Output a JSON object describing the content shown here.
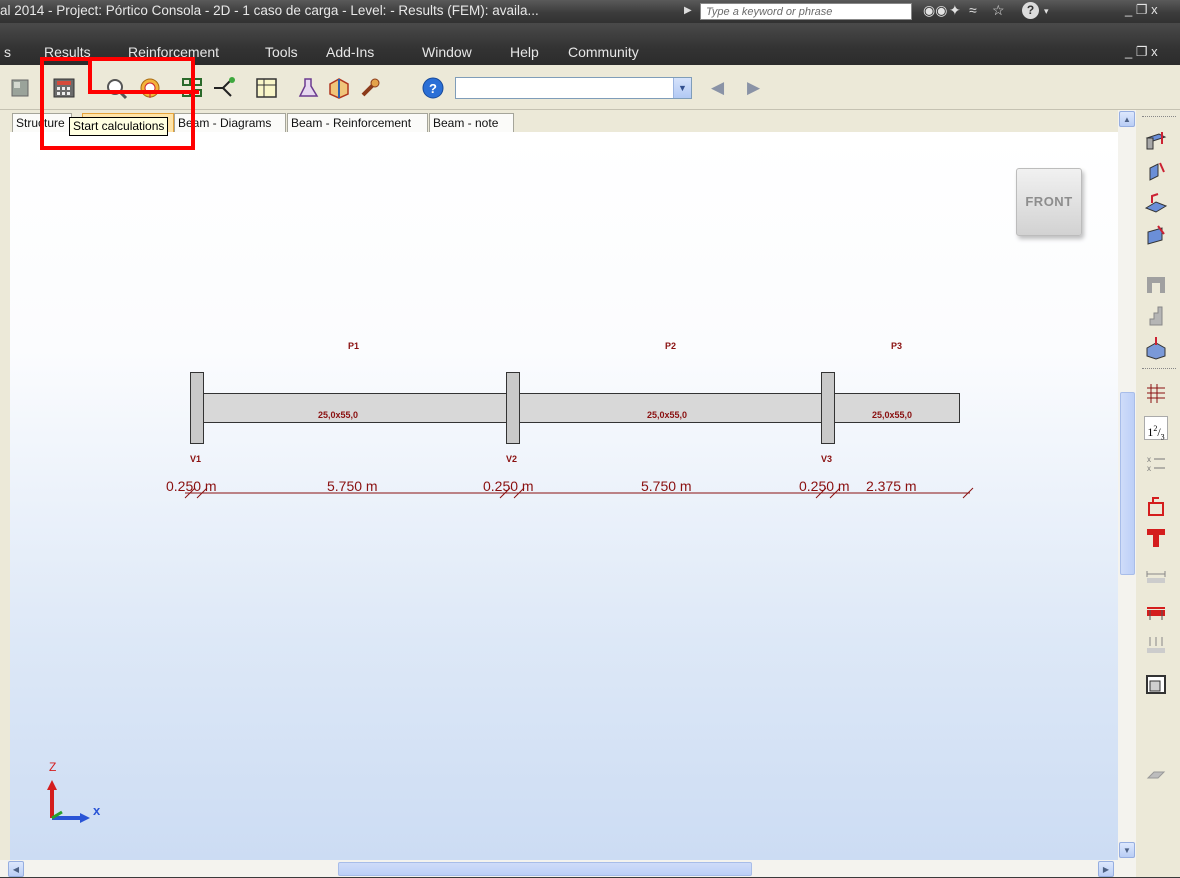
{
  "window": {
    "title": "al 2014 - Project: Pórtico Consola - 2D - 1 caso de carga - Level:  - Results (FEM): availa...",
    "search_placeholder": "Type a keyword or phrase",
    "window_controls": "_ ❐ x"
  },
  "menu": {
    "items": [
      "s",
      "Results",
      "Reinforcement",
      "Tools",
      "Add-Ins",
      "Window",
      "Help",
      "Community"
    ],
    "window_controls": "_ ❐ x"
  },
  "toolbar": {
    "icons": [
      "toolbar-icon",
      "calculator-icon",
      "zoom-icon",
      "target-icon",
      "nodes-icon",
      "arrow-branch-icon",
      "table-icon",
      "flask-icon",
      "frame-3d-icon",
      "wrench-icon",
      "help-icon"
    ],
    "combo_value": "",
    "nav_prev": "◀",
    "nav_next": "▶"
  },
  "tabs": [
    "Structure",
    "Beam - View",
    "Beam - Diagrams",
    "Beam - Reinforcement",
    "Beam - note"
  ],
  "tooltip": "Start calculations",
  "viewcube": {
    "label": "FRONT"
  },
  "structure": {
    "spans": [
      {
        "name": "P1",
        "section": "25,0x55,0"
      },
      {
        "name": "P2",
        "section": "25,0x55,0"
      },
      {
        "name": "P3",
        "section": "25,0x55,0"
      }
    ],
    "supports": [
      "V1",
      "V2",
      "V3"
    ],
    "dimensions": [
      "0.250 m",
      "5.750 m",
      "0.250 m",
      "5.750 m",
      "0.250 m",
      "2.375 m"
    ]
  },
  "axes": {
    "z": "Z",
    "x": "x"
  },
  "colors": {
    "highlight": "#ff0000",
    "dimension": "#8a1010",
    "titlebar": "#3c3c3c"
  }
}
